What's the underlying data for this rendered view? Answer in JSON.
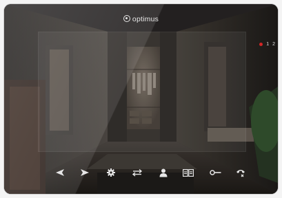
{
  "brand": {
    "name": "optimus"
  },
  "channels": {
    "recording_color": "#d32626",
    "items": [
      "1",
      "2"
    ]
  },
  "toolbar": {
    "buttons": [
      {
        "name": "prev-button",
        "icon": "triangle-left-icon"
      },
      {
        "name": "next-button",
        "icon": "triangle-right-icon"
      },
      {
        "name": "settings-button",
        "icon": "gear-icon"
      },
      {
        "name": "switch-button",
        "icon": "swap-arrows-icon"
      },
      {
        "name": "user-button",
        "icon": "person-icon"
      },
      {
        "name": "gallery-button",
        "icon": "book-icon"
      },
      {
        "name": "door-open-button",
        "icon": "key-icon"
      },
      {
        "name": "call-button",
        "icon": "phone-icon"
      }
    ]
  },
  "colors": {
    "icon": "#e6e6e6",
    "frame": "#121212"
  }
}
